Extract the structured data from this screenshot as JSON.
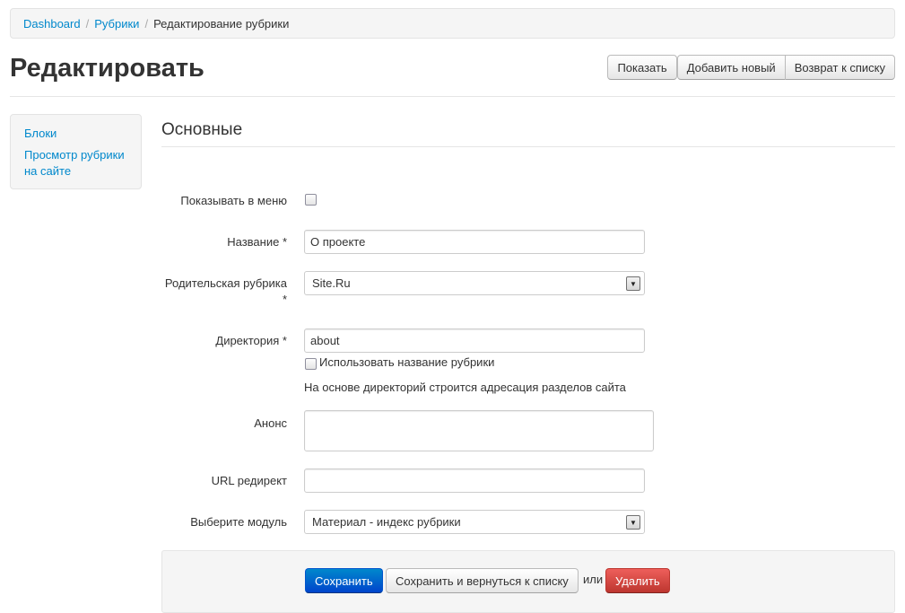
{
  "breadcrumb": {
    "items": [
      "Dashboard",
      "Рубрики"
    ],
    "separator": "/",
    "current": "Редактирование рубрики"
  },
  "header": {
    "title": "Редактировать",
    "actions": {
      "show": "Показать",
      "add_new": "Добавить новый",
      "back_to_list": "Возврат к списку"
    }
  },
  "sidebar": {
    "items": [
      "Блоки",
      "Просмотр рубрики на сайте"
    ]
  },
  "section": {
    "title": "Основные"
  },
  "form": {
    "show_in_menu": {
      "label": "Показывать в меню",
      "checked": false
    },
    "name": {
      "label": "Название *",
      "value": "О проекте"
    },
    "parent": {
      "label": "Родительская рубрика *",
      "value": "Site.Ru"
    },
    "directory": {
      "label": "Директория *",
      "value": "about",
      "use_name_label": "Использовать название рубрики",
      "use_name_checked": false,
      "help": "На основе директорий строится адресация разделов сайта"
    },
    "announce": {
      "label": "Анонс",
      "value": ""
    },
    "redirect": {
      "label": "URL редирект",
      "value": ""
    },
    "module": {
      "label": "Выберите модуль",
      "value": "Материал - индекс рубрики"
    }
  },
  "actions": {
    "save": "Сохранить",
    "save_and_back": "Сохранить и вернуться к списку",
    "or": "или",
    "delete": "Удалить"
  },
  "colors": {
    "link": "#0088cc",
    "primary": "#0044cc",
    "danger": "#bd362f"
  }
}
